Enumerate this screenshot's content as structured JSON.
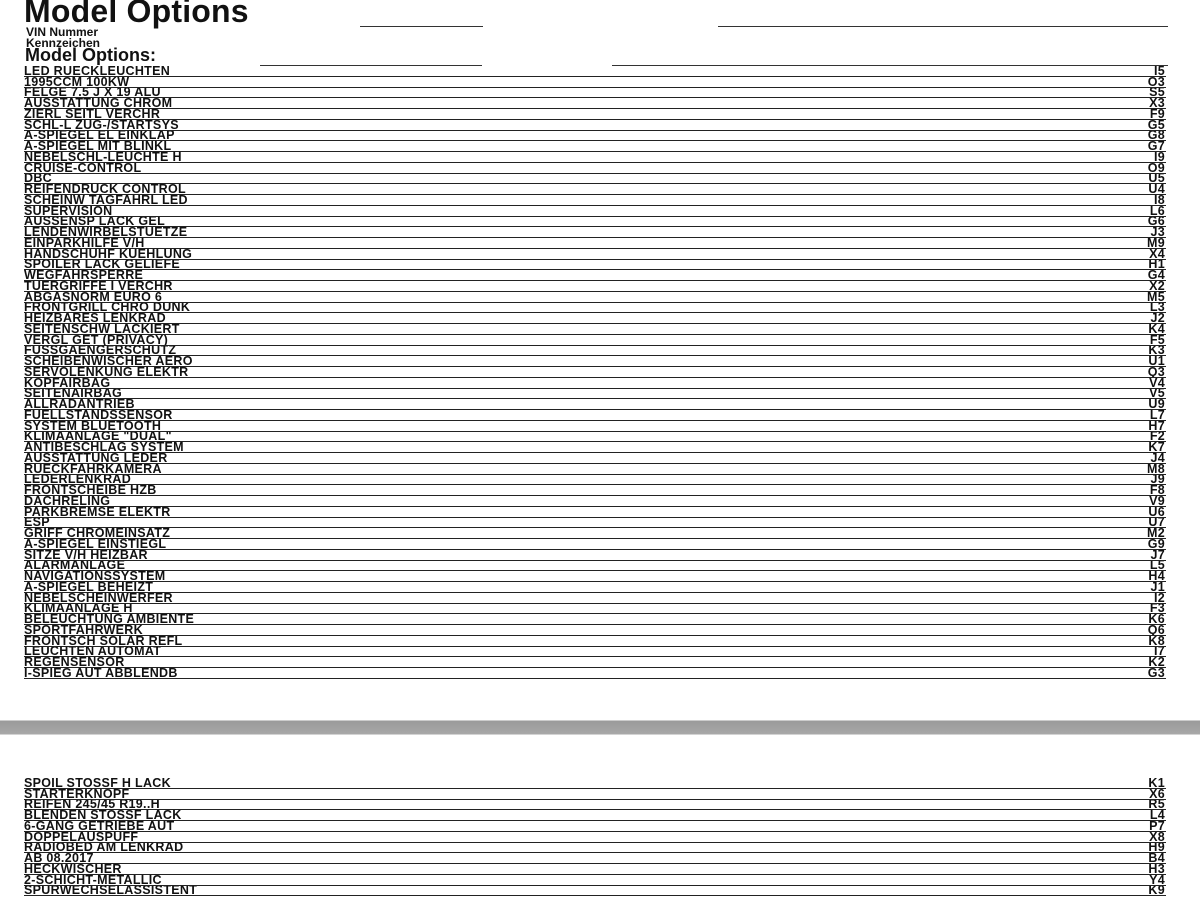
{
  "header": {
    "title": "Model Options",
    "vin_label": "VIN Nummer",
    "plate_label": "Kennzeichen",
    "subtitle": "Model Options:"
  },
  "page1_options": [
    {
      "name": "LED RUECKLEUCHTEN",
      "code": "I5"
    },
    {
      "name": "1995CCM 100KW",
      "code": "O3"
    },
    {
      "name": "FELGE 7.5 J X 19 ALU",
      "code": "S5"
    },
    {
      "name": "AUSSTATTUNG CHROM",
      "code": "X3"
    },
    {
      "name": "ZIERL SEITL VERCHR",
      "code": "F9"
    },
    {
      "name": "SCHL-L ZUG-/STARTSYS",
      "code": "G5"
    },
    {
      "name": "A-SPIEGEL EL EINKLAP",
      "code": "G8"
    },
    {
      "name": "A-SPIEGEL MIT BLINKL",
      "code": "G7"
    },
    {
      "name": "NEBELSCHL-LEUCHTE H",
      "code": "I9"
    },
    {
      "name": "CRUISE-CONTROL",
      "code": "O9"
    },
    {
      "name": "DBC",
      "code": "U5"
    },
    {
      "name": "REIFENDRUCK CONTROL",
      "code": "U4"
    },
    {
      "name": "SCHEINW TAGFAHRL LED",
      "code": "I8"
    },
    {
      "name": "SUPERVISION",
      "code": "L6"
    },
    {
      "name": "AUSSENSP LACK GEL",
      "code": "G6"
    },
    {
      "name": "LENDENWIRBELSTUETZE",
      "code": "J3"
    },
    {
      "name": "EINPARKHILFE V/H",
      "code": "M9"
    },
    {
      "name": "HANDSCHUHF KUEHLUNG",
      "code": "X4"
    },
    {
      "name": "SPOILER LACK GELIEFE",
      "code": "H1"
    },
    {
      "name": "WEGFAHRSPERRE",
      "code": "G4"
    },
    {
      "name": "TUERGRIFFE I VERCHR",
      "code": "X2"
    },
    {
      "name": "ABGASNORM EURO 6",
      "code": "M5"
    },
    {
      "name": "FRONTGRILL CHRO DUNK",
      "code": "L3"
    },
    {
      "name": "HEIZBARES LENKRAD",
      "code": "J2"
    },
    {
      "name": "SEITENSCHW LACKIERT",
      "code": "K4"
    },
    {
      "name": "VERGL GET (PRIVACY)",
      "code": "F5"
    },
    {
      "name": "FUSSGAENGERSCHUTZ",
      "code": "K3"
    },
    {
      "name": "SCHEIBENWISCHER AERO",
      "code": "U1"
    },
    {
      "name": "SERVOLENKUNG ELEKTR",
      "code": "Q3"
    },
    {
      "name": "KOPFAIRBAG",
      "code": "V4"
    },
    {
      "name": "SEITENAIRBAG",
      "code": "V5"
    },
    {
      "name": "ALLRADANTRIEB",
      "code": "U9"
    },
    {
      "name": "FUELLSTANDSSENSOR",
      "code": "L7"
    },
    {
      "name": "SYSTEM BLUETOOTH",
      "code": "H7"
    },
    {
      "name": "KLIMAANLAGE \"DUAL\"",
      "code": "F2"
    },
    {
      "name": "ANTIBESCHLAG SYSTEM",
      "code": "K7"
    },
    {
      "name": "AUSSTATTUNG LEDER",
      "code": "J4"
    },
    {
      "name": "RUECKFAHRKAMERA",
      "code": "M8"
    },
    {
      "name": "LEDERLENKRAD",
      "code": "J9"
    },
    {
      "name": "FRONTSCHEIBE HZB",
      "code": "F8"
    },
    {
      "name": "DACHRELING",
      "code": "V9"
    },
    {
      "name": "PARKBREMSE ELEKTR",
      "code": "U6"
    },
    {
      "name": "ESP",
      "code": "U7"
    },
    {
      "name": "GRIFF CHROMEINSATZ",
      "code": "M2"
    },
    {
      "name": "A-SPIEGEL EINSTIEGL",
      "code": "G9"
    },
    {
      "name": "SITZE V/H HEIZBAR",
      "code": "J7"
    },
    {
      "name": "ALARMANLAGE",
      "code": "L5"
    },
    {
      "name": "NAVIGATIONSSYSTEM",
      "code": "H4"
    },
    {
      "name": "A-SPIEGEL BEHEIZT",
      "code": "J1"
    },
    {
      "name": "NEBELSCHEINWERFER",
      "code": "I2"
    },
    {
      "name": "KLIMAANLAGE H",
      "code": "F3"
    },
    {
      "name": "BELEUCHTUNG AMBIENTE",
      "code": "K6"
    },
    {
      "name": "SPORTFAHRWERK",
      "code": "Q6"
    },
    {
      "name": "FRONTSCH SOLAR REFL",
      "code": "K8"
    },
    {
      "name": "LEUCHTEN AUTOMAT",
      "code": "I7"
    },
    {
      "name": "REGENSENSOR",
      "code": "K2"
    },
    {
      "name": "I-SPIEG AUT ABBLENDB",
      "code": "G3"
    }
  ],
  "page2_options": [
    {
      "name": "SPOIL STOSSF H LACK",
      "code": "K1"
    },
    {
      "name": "STARTERKNOPF",
      "code": "X6"
    },
    {
      "name": "REIFEN 245/45 R19..H",
      "code": "R5"
    },
    {
      "name": "BLENDEN STOSSF LACK",
      "code": "L4"
    },
    {
      "name": "6-GANG GETRIEBE AUT",
      "code": "P7"
    },
    {
      "name": "DOPPELAUSPUFF",
      "code": "X8"
    },
    {
      "name": "RADIOBED AM LENKRAD",
      "code": "H9"
    },
    {
      "name": "AB 08.2017",
      "code": "B4"
    },
    {
      "name": "HECKWISCHER",
      "code": "H3"
    },
    {
      "name": "2-SCHICHT-METALLIC",
      "code": "Y4"
    },
    {
      "name": "SPURWECHSELASSISTENT",
      "code": "K9"
    }
  ]
}
